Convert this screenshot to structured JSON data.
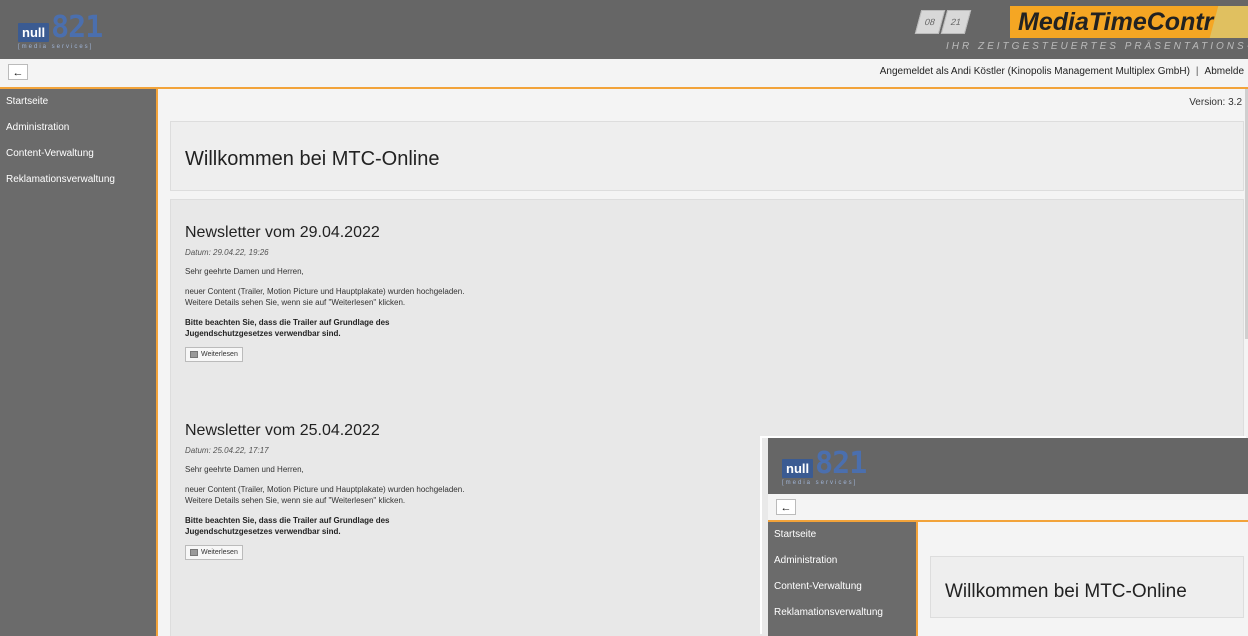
{
  "header": {
    "logo_null": "null",
    "logo_num": "821",
    "logo_sub": "[media services]",
    "mtc_boxes": [
      "08",
      "21"
    ],
    "mtc_brand": "MediaTimeControl",
    "mtc_tagline": "IHR ZEITGESTEUERTES PRÄSENTATIONS-SYSTEM"
  },
  "userbar": {
    "back_icon": "←",
    "logged_in": "Angemeldet als Andi Köstler (Kinopolis Management Multiplex GmbH)",
    "separator": "|",
    "logout": "Abmelde"
  },
  "sidebar": {
    "items": [
      {
        "label": "Startseite"
      },
      {
        "label": "Administration"
      },
      {
        "label": "Content-Verwaltung"
      },
      {
        "label": "Reklamationsverwaltung"
      }
    ]
  },
  "content": {
    "version": "Version: 3.2",
    "welcome": "Willkommen bei MTC-Online"
  },
  "newsletters": [
    {
      "title": "Newsletter vom 29.04.2022",
      "date": "Datum: 29.04.22, 19:26",
      "greeting": "Sehr geehrte Damen und Herren,",
      "line1": "neuer Content (Trailer, Motion Picture und Hauptplakate) wurden hochgeladen.",
      "line2": "Weitere Details sehen Sie, wenn sie auf \"Weiterlesen\" klicken.",
      "bold1": "Bitte beachten Sie, dass die Trailer auf Grundlage des",
      "bold2": "Jugendschutzgesetzes verwendbar sind.",
      "button": "Weiterlesen"
    },
    {
      "title": "Newsletter vom 25.04.2022",
      "date": "Datum: 25.04.22, 17:17",
      "greeting": "Sehr geehrte Damen und Herren,",
      "line1": "neuer Content (Trailer, Motion Picture und Hauptplakate) wurden hochgeladen.",
      "line2": "Weitere Details sehen Sie, wenn sie auf \"Weiterlesen\" klicken.",
      "bold1": "Bitte beachten Sie, dass die Trailer auf Grundlage des",
      "bold2": "Jugendschutzgesetzes verwendbar sind.",
      "button": "Weiterlesen"
    }
  ],
  "colors": {
    "header_bg": "#666666",
    "accent": "#f2a33a",
    "sidebar_bg": "#6b6b6b",
    "brand_orange": "#f5a623"
  },
  "icons": {
    "back": "arrow-left-icon",
    "document": "document-icon"
  }
}
